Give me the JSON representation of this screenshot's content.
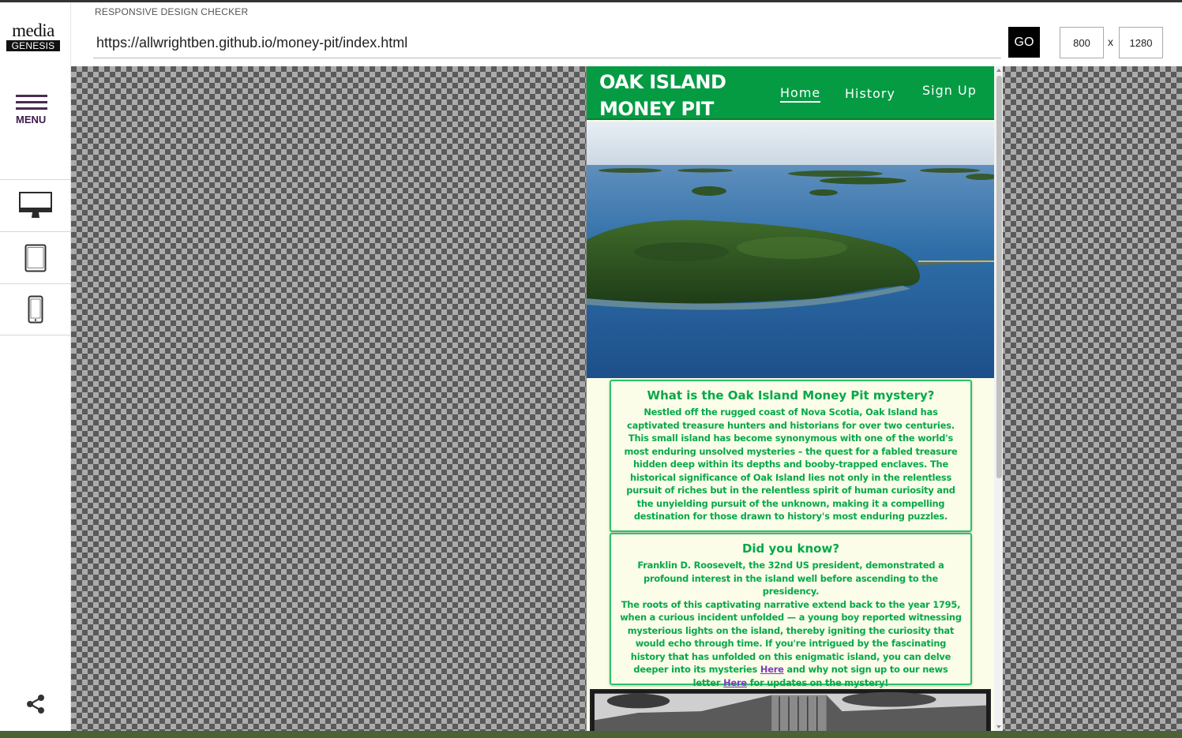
{
  "app": {
    "title": "RESPONSIVE DESIGN CHECKER",
    "logo_top": "media",
    "logo_bottom": "GENESIS",
    "menu_label": "MENU"
  },
  "toolbar": {
    "url": "https://allwrightben.github.io/money-pit/index.html",
    "go_label": "GO",
    "width_value": "800",
    "height_value": "1280",
    "separator": "x"
  },
  "devices": [
    {
      "icon": "desktop-icon"
    },
    {
      "icon": "tablet-icon"
    },
    {
      "icon": "phone-icon"
    }
  ],
  "share": {
    "icon": "share-icon"
  },
  "site": {
    "logo_line1": "OAK ISLAND",
    "logo_line2": "MONEY PIT",
    "nav": {
      "home": "Home",
      "history": "History",
      "signup": "Sign Up"
    },
    "card1": {
      "heading": "What is the Oak Island Money Pit mystery?",
      "body": "Nestled off the rugged coast of Nova Scotia, Oak Island has captivated treasure hunters and historians for over two centuries. This small island has become synonymous with one of the world's most enduring unsolved mysteries – the quest for a fabled treasure hidden deep within its depths and booby-trapped enclaves. The historical significance of Oak Island lies not only in the relentless pursuit of riches but in the relentless spirit of human curiosity and the unyielding pursuit of the unknown, making it a compelling destination for those drawn to history's most enduring puzzles."
    },
    "card2": {
      "heading": "Did you know?",
      "line1": "Franklin D. Roosevelt, the 32nd US president, demonstrated a profound interest in the island well before ascending to the presidency.",
      "line2": "The roots of this captivating narrative extend back to the year 1795, when a curious incident unfolded — a young boy reported witnessing mysterious lights on the island, thereby igniting the curiosity that would echo through time. If you're intrigued by the fascinating history that has unfolded on this enigmatic island, you can delve deeper into its mysteries",
      "link1": "Here",
      "middle": "and why not sign up to our news letter",
      "link2": "Here",
      "end": "for updates on the mystery!"
    }
  },
  "colors": {
    "site_green": "#059b43",
    "text_green": "#06a84a",
    "link_purple": "#7a3dbd",
    "menu_purple": "#4a2a55"
  }
}
